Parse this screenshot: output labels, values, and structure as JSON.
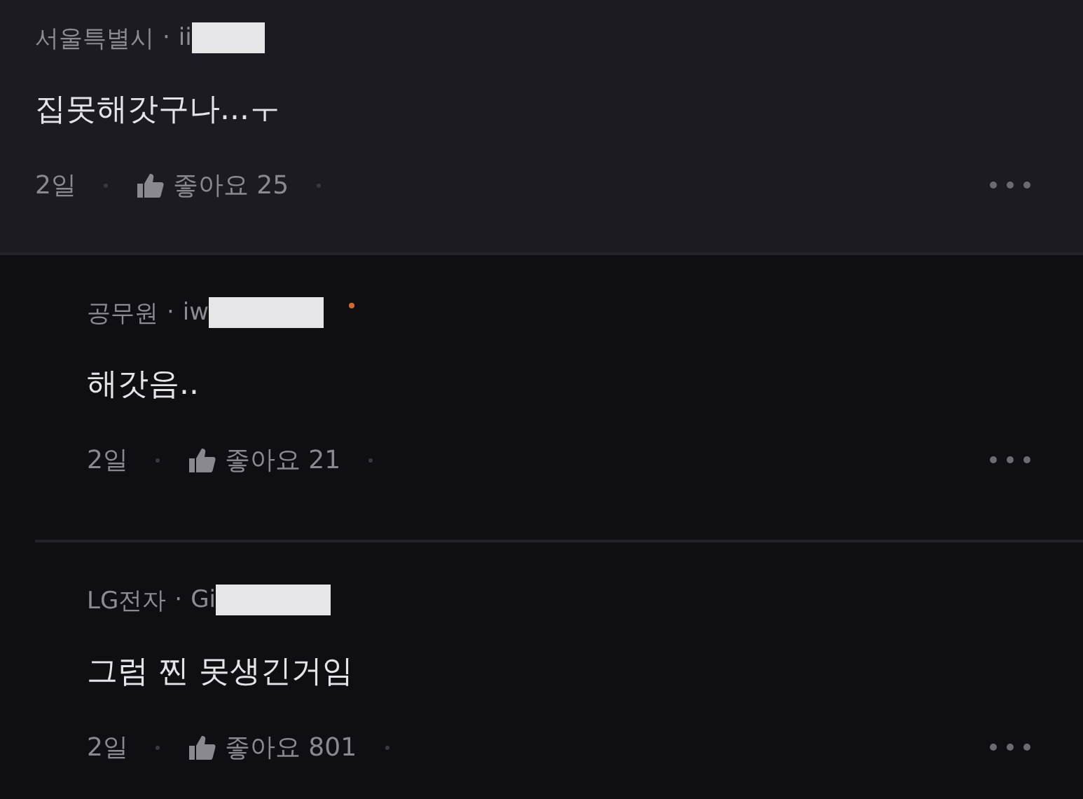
{
  "comments": [
    {
      "kind": "comment",
      "company": "서울특별시",
      "separator": "·",
      "user": "ii",
      "redacted": true,
      "has_badge": false,
      "text": "집못해갓구나...ㅜ",
      "age": "2일",
      "like_label": "좋아요",
      "likes": "25"
    },
    {
      "kind": "reply",
      "company": "공무원",
      "separator": "·",
      "user": "iw",
      "redacted": true,
      "has_badge": true,
      "text": "해갓음..",
      "age": "2일",
      "like_label": "좋아요",
      "likes": "21"
    },
    {
      "kind": "reply",
      "company": "LG전자",
      "separator": "·",
      "user": "Gi",
      "redacted": true,
      "has_badge": false,
      "text": "그럼 찐 못생긴거임",
      "age": "2일",
      "like_label": "좋아요",
      "likes": "801"
    }
  ]
}
